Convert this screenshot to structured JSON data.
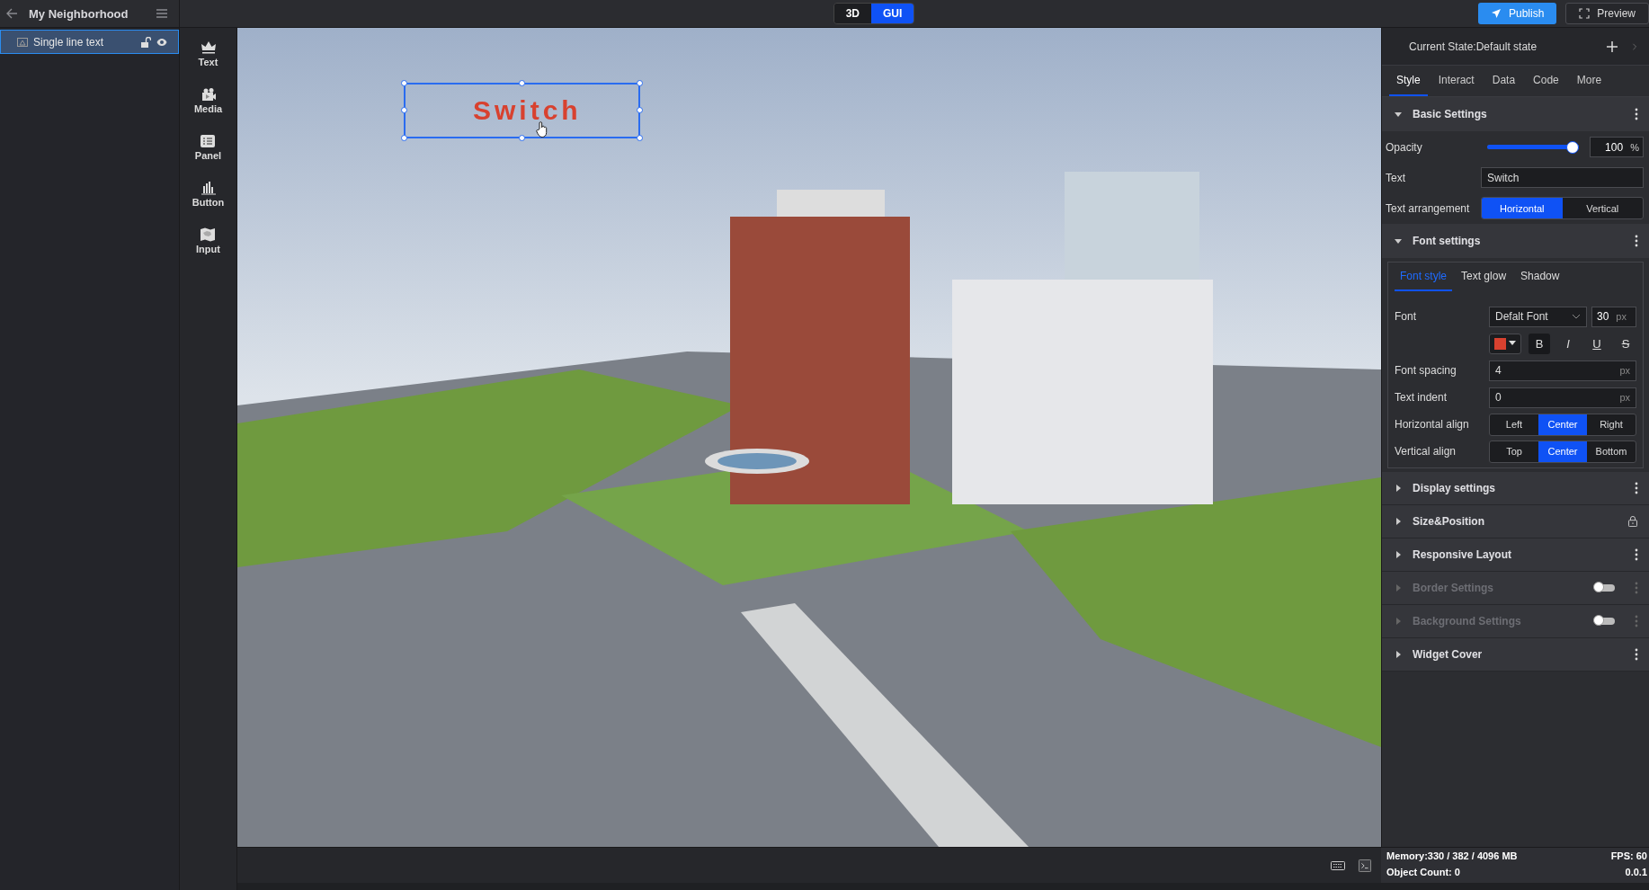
{
  "header": {
    "title": "My Neighborhood"
  },
  "layers": [
    {
      "label": "Single line text",
      "selected": true,
      "locked": false,
      "visible": true
    }
  ],
  "widgets": [
    {
      "label": "Text",
      "kind": "text"
    },
    {
      "label": "Media",
      "kind": "media"
    },
    {
      "label": "Panel",
      "kind": "panel"
    },
    {
      "label": "Button",
      "kind": "button"
    },
    {
      "label": "Input",
      "kind": "input"
    }
  ],
  "mode_tabs": [
    {
      "label": "3D",
      "selected": false
    },
    {
      "label": "GUI",
      "selected": true
    }
  ],
  "actions": [
    {
      "label": "Publish",
      "kind": "primary"
    },
    {
      "label": "Preview",
      "kind": "secondary"
    }
  ],
  "canvas": {
    "text": "Switch",
    "color": "#d8412f",
    "selected": true
  },
  "inspector": {
    "state": "Current State:Default state",
    "tabs": [
      {
        "label": "Style",
        "selected": true
      },
      {
        "label": "Interact",
        "selected": false
      },
      {
        "label": "Data",
        "selected": false
      },
      {
        "label": "Code",
        "selected": false
      },
      {
        "label": "More",
        "selected": false
      }
    ],
    "basic": {
      "title": "Basic Settings",
      "expanded": true,
      "opacity": {
        "label": "Opacity",
        "level": 1.0,
        "value": "100",
        "unit": "%"
      },
      "text": {
        "label": "Text",
        "value": "Switch"
      },
      "arrangement": {
        "label": "Text arrangement",
        "options": [
          {
            "label": "Horizontal",
            "selected": true
          },
          {
            "label": "Vertical",
            "selected": false
          }
        ]
      }
    },
    "font": {
      "title": "Font settings",
      "expanded": true,
      "tabs": [
        {
          "label": "Font style",
          "selected": true
        },
        {
          "label": "Text glow",
          "selected": false
        },
        {
          "label": "Shadow",
          "selected": false
        }
      ],
      "font": {
        "label": "Font",
        "value": "Defalt Font",
        "size": "30",
        "unit": "px",
        "color": "#d8412f"
      },
      "styles": [
        {
          "glyph": "B",
          "kind": "bold",
          "active": true
        },
        {
          "glyph": "I",
          "kind": "italic",
          "active": false
        },
        {
          "glyph": "U",
          "kind": "underline",
          "active": false
        },
        {
          "glyph": "S",
          "kind": "strike",
          "active": false
        }
      ],
      "spacing": {
        "label": "Font spacing",
        "value": "4",
        "unit": "px"
      },
      "indent": {
        "label": "Text indent",
        "value": "0",
        "unit": "px"
      },
      "halign": {
        "label": "Horizontal align",
        "options": [
          {
            "label": "Left",
            "selected": false
          },
          {
            "label": "Center",
            "selected": true
          },
          {
            "label": "Right",
            "selected": false
          }
        ]
      },
      "valign": {
        "label": "Vertical align",
        "options": [
          {
            "label": "Top",
            "selected": false
          },
          {
            "label": "Center",
            "selected": true
          },
          {
            "label": "Bottom",
            "selected": false
          }
        ]
      }
    },
    "sections": [
      {
        "label": "Display settings",
        "kind": "menu",
        "disabled": false
      },
      {
        "label": "Size&Position",
        "kind": "lock",
        "disabled": false
      },
      {
        "label": "Responsive Layout",
        "kind": "menu",
        "disabled": false
      },
      {
        "label": "Border Settings",
        "kind": "toggle",
        "on": false,
        "disabled": true
      },
      {
        "label": "Background Settings",
        "kind": "toggle",
        "on": false,
        "disabled": true
      },
      {
        "label": "Widget Cover",
        "kind": "menu",
        "disabled": false
      }
    ]
  },
  "status": {
    "memory": "Memory:330 / 382 / 4096 MB",
    "fps": "FPS: 60",
    "objects": "Object Count: 0",
    "version": "0.0.1"
  }
}
